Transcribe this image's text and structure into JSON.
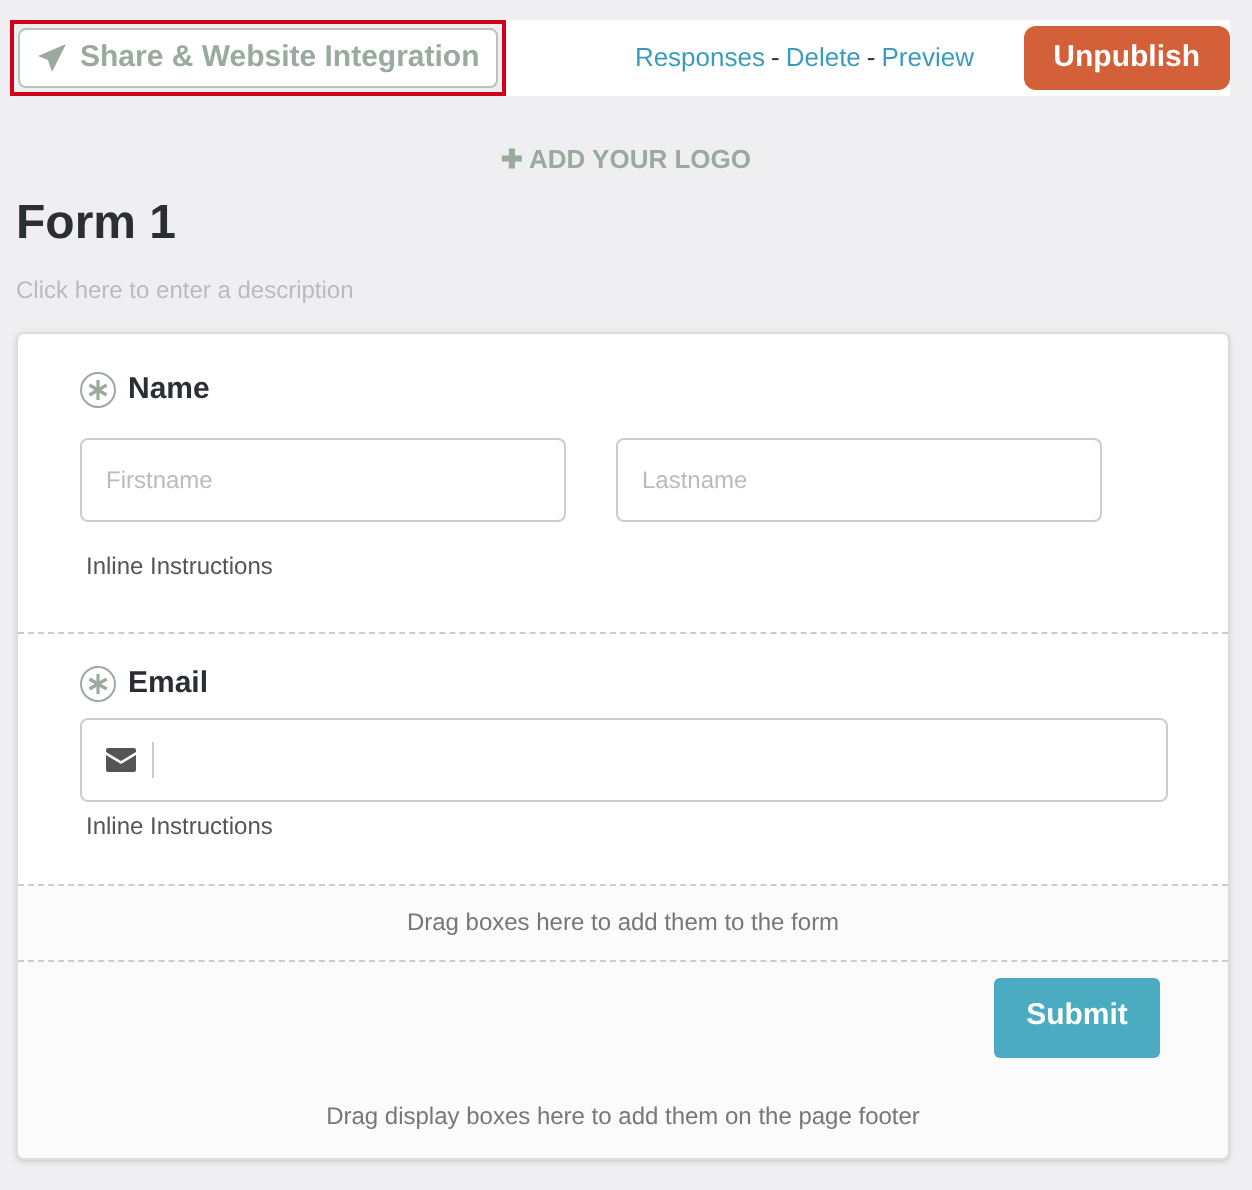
{
  "toolbar": {
    "share_button": {
      "label": "Share & Website Integration",
      "highlighted": true
    },
    "links": [
      "Responses",
      "Delete",
      "Preview"
    ],
    "separator": "-",
    "unpublish_button": "Unpublish"
  },
  "add_logo": {
    "icon": "✚",
    "label": "ADD YOUR LOGO"
  },
  "form": {
    "title": "Form 1",
    "description_placeholder": "Click here to enter a description",
    "fields": [
      {
        "kind": "name",
        "label": "Name",
        "required": true,
        "placeholders": [
          "Firstname",
          "Lastname"
        ],
        "instructions": "Inline Instructions"
      },
      {
        "kind": "email",
        "label": "Email",
        "required": true,
        "instructions": "Inline Instructions"
      }
    ],
    "drop_zone": "Drag boxes here to add them to the form",
    "submit_button": "Submit",
    "footer_drop_zone": "Drag display boxes here to add them on the page footer"
  }
}
